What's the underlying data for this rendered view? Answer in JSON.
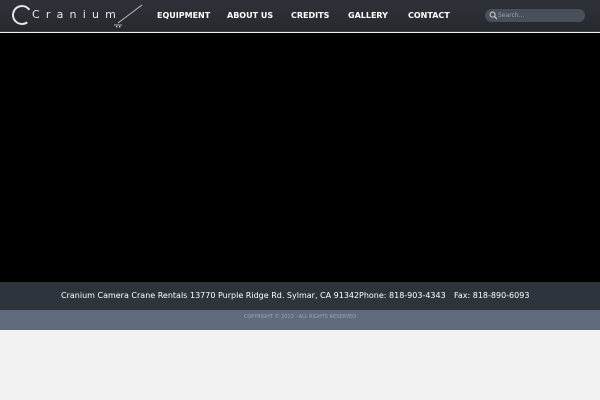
{
  "header": {
    "logo": {
      "text": "Cranium"
    },
    "nav": {
      "equipment": "EQUIPMENT",
      "about_us": "ABOUT US",
      "credits": "CREDITS",
      "gallery": "GALLERY",
      "contact": "CONTACT"
    },
    "search": {
      "placeholder": "Search..."
    }
  },
  "footer": {
    "company": "Cranium Camera Crane Rentals",
    "address": "13770 Purple Ridge Rd. Sylmar, CA 91342",
    "phone": "Phone: 818-903-4343",
    "fax": "Fax: 818-890-6093",
    "copyright": "COPYRIGHT © 2013 · ALL RIGHTS RESERVED"
  },
  "colors": {
    "header_bg": "#2b2f35",
    "hero_bg": "#000000",
    "contact_bar_bg": "#2e343b",
    "copyright_bar_bg": "#606c7d",
    "page_bg": "#f2f2f2"
  },
  "icons": [
    "crane-logo-icon",
    "search-icon"
  ]
}
